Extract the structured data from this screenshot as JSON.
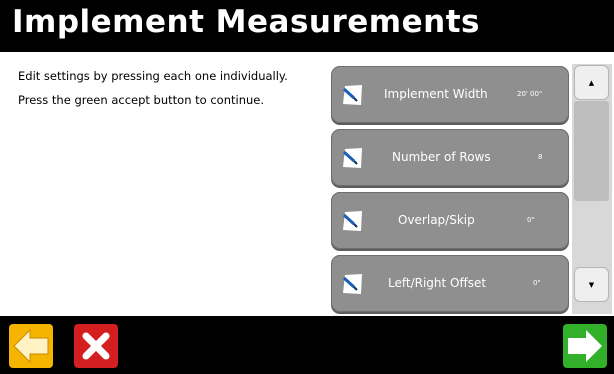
{
  "header": {
    "title": "Implement Measurements"
  },
  "instructions": {
    "line1": "Edit settings by pressing each one individually.",
    "line2": "Press the green accept button to continue."
  },
  "settings": [
    {
      "label": "Implement Width",
      "value": "20' 00\""
    },
    {
      "label": "Number of Rows",
      "value": "8"
    },
    {
      "label": "Overlap/Skip",
      "value": "0\""
    },
    {
      "label": "Left/Right Offset",
      "value": "0\""
    }
  ],
  "scrollbar": {
    "up_glyph": "▲",
    "down_glyph": "▼"
  },
  "icons": {
    "setting": "edit-pencil-icon",
    "back": "back-arrow-icon",
    "cancel": "cancel-x-icon",
    "accept": "accept-arrow-icon"
  },
  "colors": {
    "back": "#f5b400",
    "cancel": "#d31f1f",
    "accept": "#32b02a",
    "setting_button": "#8f8f8f"
  }
}
